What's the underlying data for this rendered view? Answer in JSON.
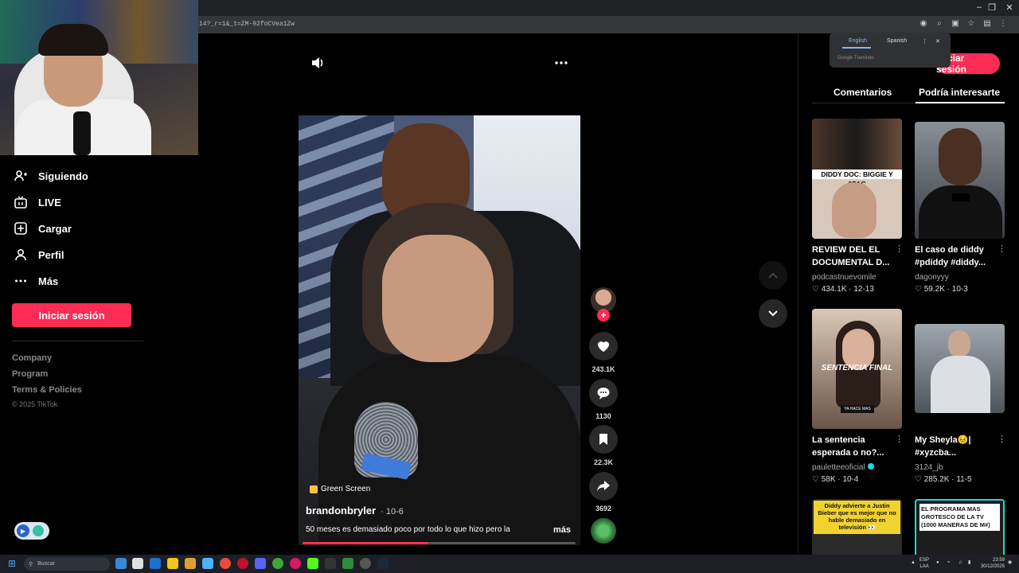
{
  "browser": {
    "url": "14?_r=1&_t=ZM-92foCVea1Zw",
    "window_controls": [
      "–",
      "❐",
      "✕"
    ]
  },
  "translate_popup": {
    "tab_active": "English",
    "tab_other": "Spanish",
    "note": "Google Translate"
  },
  "sidebar": {
    "items": [
      {
        "label": "Siguiendo",
        "icon": "user-follow-icon"
      },
      {
        "label": "LIVE",
        "icon": "live-tv-icon"
      },
      {
        "label": "Cargar",
        "icon": "upload-plus-icon"
      },
      {
        "label": "Perfil",
        "icon": "profile-icon"
      },
      {
        "label": "Más",
        "icon": "more-dots-icon"
      }
    ],
    "login_button": "Iniciar sesión",
    "footer_links": [
      "Company",
      "Program",
      "Terms & Policies"
    ],
    "copyright": "© 2025 TikTok"
  },
  "video": {
    "effect_tag": "Green Screen",
    "author": "brandonbryler",
    "date": "· 10-6",
    "caption": "50 meses es demasiado poco por todo lo que hizo pero la",
    "more_label": "más",
    "progress": 0.46,
    "likes": "243.1K",
    "comments": "1130",
    "saves": "22.3K",
    "shares": "3692"
  },
  "right_panel": {
    "login_button": "Iniciar sesión",
    "tabs": [
      "Comentarios",
      "Podría interesarte"
    ],
    "active_tab": "Podría interesarte",
    "cards": [
      {
        "thumb_text": "DIDDY DOC: BIGGIE Y 2PAC",
        "title": "REVIEW DEL EL DOCUMENTAL D...",
        "user": "podcastnuevomile",
        "likes": "434.1K",
        "date": "12-13",
        "verified": false
      },
      {
        "thumb_text": "",
        "title": "El caso de diddy #pdiddy #diddy...",
        "user": "dagonyyy",
        "likes": "59.2K",
        "date": "10-3",
        "verified": false
      },
      {
        "thumb_text": "SENTENCIA FINAL",
        "thumb_sub": "YA HACE MAS",
        "title": "La sentencia esperada o no?...",
        "user": "paulette​eoficial",
        "likes": "58K",
        "date": "10-4",
        "verified": true
      },
      {
        "thumb_text": "",
        "title": "My Sheyla😣| #xyzcba...",
        "user": "3124_jb",
        "likes": "285.2K",
        "date": "11-5",
        "verified": false
      },
      {
        "thumb_text": "Diddy advierte a Justin Bieber que es mejor que no hable demasiado en televisión 👀"
      },
      {
        "thumb_text": "EL PROGRAMA MAS GROTESCO DE LA TV (1000 MANERAS DE M#)"
      }
    ]
  },
  "taskbar": {
    "search_placeholder": "Buscar",
    "lang_line1": "ESP",
    "lang_line2": "LAA",
    "time": "23:59",
    "date": "30/12/2025"
  },
  "colors": {
    "accent": "#fe2c55",
    "background": "#000000",
    "verified": "#20d5ec"
  }
}
